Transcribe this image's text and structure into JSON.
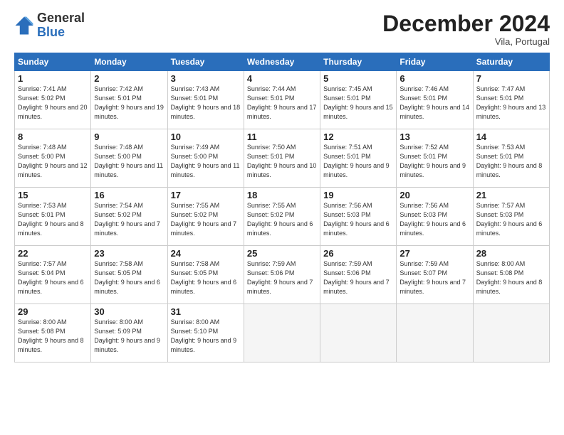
{
  "logo": {
    "general": "General",
    "blue": "Blue"
  },
  "title": "December 2024",
  "location": "Vila, Portugal",
  "days_header": [
    "Sunday",
    "Monday",
    "Tuesday",
    "Wednesday",
    "Thursday",
    "Friday",
    "Saturday"
  ],
  "weeks": [
    [
      {
        "day": "1",
        "sunrise": "7:41 AM",
        "sunset": "5:02 PM",
        "daylight": "9 hours and 20 minutes."
      },
      {
        "day": "2",
        "sunrise": "7:42 AM",
        "sunset": "5:01 PM",
        "daylight": "9 hours and 19 minutes."
      },
      {
        "day": "3",
        "sunrise": "7:43 AM",
        "sunset": "5:01 PM",
        "daylight": "9 hours and 18 minutes."
      },
      {
        "day": "4",
        "sunrise": "7:44 AM",
        "sunset": "5:01 PM",
        "daylight": "9 hours and 17 minutes."
      },
      {
        "day": "5",
        "sunrise": "7:45 AM",
        "sunset": "5:01 PM",
        "daylight": "9 hours and 15 minutes."
      },
      {
        "day": "6",
        "sunrise": "7:46 AM",
        "sunset": "5:01 PM",
        "daylight": "9 hours and 14 minutes."
      },
      {
        "day": "7",
        "sunrise": "7:47 AM",
        "sunset": "5:01 PM",
        "daylight": "9 hours and 13 minutes."
      }
    ],
    [
      {
        "day": "8",
        "sunrise": "7:48 AM",
        "sunset": "5:00 PM",
        "daylight": "9 hours and 12 minutes."
      },
      {
        "day": "9",
        "sunrise": "7:48 AM",
        "sunset": "5:00 PM",
        "daylight": "9 hours and 11 minutes."
      },
      {
        "day": "10",
        "sunrise": "7:49 AM",
        "sunset": "5:00 PM",
        "daylight": "9 hours and 11 minutes."
      },
      {
        "day": "11",
        "sunrise": "7:50 AM",
        "sunset": "5:01 PM",
        "daylight": "9 hours and 10 minutes."
      },
      {
        "day": "12",
        "sunrise": "7:51 AM",
        "sunset": "5:01 PM",
        "daylight": "9 hours and 9 minutes."
      },
      {
        "day": "13",
        "sunrise": "7:52 AM",
        "sunset": "5:01 PM",
        "daylight": "9 hours and 9 minutes."
      },
      {
        "day": "14",
        "sunrise": "7:53 AM",
        "sunset": "5:01 PM",
        "daylight": "9 hours and 8 minutes."
      }
    ],
    [
      {
        "day": "15",
        "sunrise": "7:53 AM",
        "sunset": "5:01 PM",
        "daylight": "9 hours and 8 minutes."
      },
      {
        "day": "16",
        "sunrise": "7:54 AM",
        "sunset": "5:02 PM",
        "daylight": "9 hours and 7 minutes."
      },
      {
        "day": "17",
        "sunrise": "7:55 AM",
        "sunset": "5:02 PM",
        "daylight": "9 hours and 7 minutes."
      },
      {
        "day": "18",
        "sunrise": "7:55 AM",
        "sunset": "5:02 PM",
        "daylight": "9 hours and 6 minutes."
      },
      {
        "day": "19",
        "sunrise": "7:56 AM",
        "sunset": "5:03 PM",
        "daylight": "9 hours and 6 minutes."
      },
      {
        "day": "20",
        "sunrise": "7:56 AM",
        "sunset": "5:03 PM",
        "daylight": "9 hours and 6 minutes."
      },
      {
        "day": "21",
        "sunrise": "7:57 AM",
        "sunset": "5:03 PM",
        "daylight": "9 hours and 6 minutes."
      }
    ],
    [
      {
        "day": "22",
        "sunrise": "7:57 AM",
        "sunset": "5:04 PM",
        "daylight": "9 hours and 6 minutes."
      },
      {
        "day": "23",
        "sunrise": "7:58 AM",
        "sunset": "5:05 PM",
        "daylight": "9 hours and 6 minutes."
      },
      {
        "day": "24",
        "sunrise": "7:58 AM",
        "sunset": "5:05 PM",
        "daylight": "9 hours and 6 minutes."
      },
      {
        "day": "25",
        "sunrise": "7:59 AM",
        "sunset": "5:06 PM",
        "daylight": "9 hours and 7 minutes."
      },
      {
        "day": "26",
        "sunrise": "7:59 AM",
        "sunset": "5:06 PM",
        "daylight": "9 hours and 7 minutes."
      },
      {
        "day": "27",
        "sunrise": "7:59 AM",
        "sunset": "5:07 PM",
        "daylight": "9 hours and 7 minutes."
      },
      {
        "day": "28",
        "sunrise": "8:00 AM",
        "sunset": "5:08 PM",
        "daylight": "9 hours and 8 minutes."
      }
    ],
    [
      {
        "day": "29",
        "sunrise": "8:00 AM",
        "sunset": "5:08 PM",
        "daylight": "9 hours and 8 minutes."
      },
      {
        "day": "30",
        "sunrise": "8:00 AM",
        "sunset": "5:09 PM",
        "daylight": "9 hours and 9 minutes."
      },
      {
        "day": "31",
        "sunrise": "8:00 AM",
        "sunset": "5:10 PM",
        "daylight": "9 hours and 9 minutes."
      },
      null,
      null,
      null,
      null
    ]
  ]
}
